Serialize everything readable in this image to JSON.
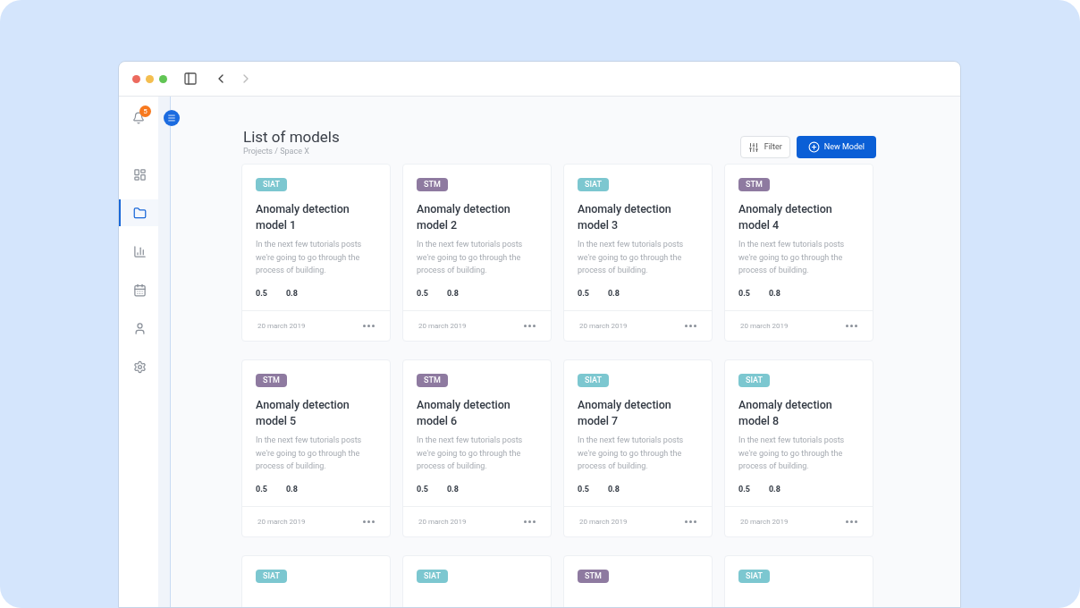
{
  "notifications": {
    "count": "5"
  },
  "sidebar": {
    "items": [
      {
        "kind": "dashboard",
        "selected": false
      },
      {
        "kind": "folder",
        "selected": true
      },
      {
        "kind": "chart",
        "selected": false
      },
      {
        "kind": "calendar",
        "selected": false
      },
      {
        "kind": "user",
        "selected": false
      },
      {
        "kind": "settings",
        "selected": false
      }
    ]
  },
  "header": {
    "title": "List of models",
    "breadcrumb": "Projects / Space X",
    "filter_button": "Filter",
    "new_button": "New Model"
  },
  "cards": [
    {
      "tag": "SIAT",
      "color": "#7cc7d0",
      "title": "Anomaly detection model 1",
      "description": "In the next few tutorials posts we're going to go through the process of building.",
      "metric_1": "0.5",
      "metric_2": "0.8",
      "date": "20 march 2019"
    },
    {
      "tag": "STM",
      "color": "#8e7aa0",
      "title": "Anomaly detection model 2",
      "description": "In the next few tutorials posts we're going to go through the process of building.",
      "metric_1": "0.5",
      "metric_2": "0.8",
      "date": "20 march 2019"
    },
    {
      "tag": "SIAT",
      "color": "#7cc7d0",
      "title": "Anomaly detection model 3",
      "description": "In the next few tutorials posts we're going to go through the process of building.",
      "metric_1": "0.5",
      "metric_2": "0.8",
      "date": "20 march 2019"
    },
    {
      "tag": "STM",
      "color": "#8e7aa0",
      "title": "Anomaly detection model 4",
      "description": "In the next few tutorials posts we're going to go through the process of building.",
      "metric_1": "0.5",
      "metric_2": "0.8",
      "date": "20 march 2019"
    },
    {
      "tag": "STM",
      "color": "#8e7aa0",
      "title": "Anomaly detection model 5",
      "description": "In the next few tutorials posts we're going to go through the process of building.",
      "metric_1": "0.5",
      "metric_2": "0.8",
      "date": "20 march 2019"
    },
    {
      "tag": "STM",
      "color": "#8e7aa0",
      "title": "Anomaly detection model 6",
      "description": "In the next few tutorials posts we're going to go through the process of building.",
      "metric_1": "0.5",
      "metric_2": "0.8",
      "date": "20 march 2019"
    },
    {
      "tag": "SIAT",
      "color": "#7cc7d0",
      "title": "Anomaly detection model 7",
      "description": "In the next few tutorials posts we're going to go through the process of building.",
      "metric_1": "0.5",
      "metric_2": "0.8",
      "date": "20 march 2019"
    },
    {
      "tag": "SIAT",
      "color": "#7cc7d0",
      "title": "Anomaly detection model 8",
      "description": "In the next few tutorials posts we're going to go through the process of building.",
      "metric_1": "0.5",
      "metric_2": "0.8",
      "date": "20 march 2019"
    },
    {
      "tag": "SIAT",
      "color": "#7cc7d0"
    },
    {
      "tag": "SIAT",
      "color": "#7cc7d0"
    },
    {
      "tag": "STM",
      "color": "#8e7aa0"
    },
    {
      "tag": "SIAT",
      "color": "#7cc7d0"
    }
  ]
}
